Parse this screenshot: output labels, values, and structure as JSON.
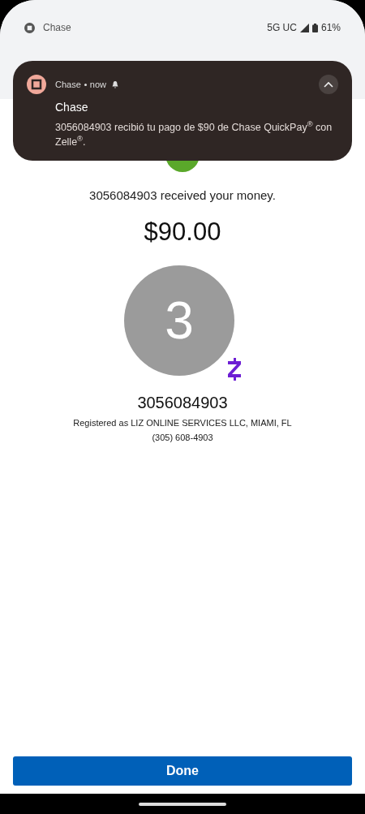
{
  "status_bar": {
    "app": "Chase",
    "network": "5G UC",
    "battery": "61%"
  },
  "notification": {
    "app": "Chase",
    "time": "now",
    "title": "Chase",
    "body": "3056084903 recibió tu pago de $90 de Chase QuickPay$^{®}$ con Zelle$^{®}$.",
    "expanded": true
  },
  "confirmation": {
    "message": "3056084903 received your money.",
    "amount": "$90.00"
  },
  "recipient": {
    "initial": "3",
    "name": "3056084903",
    "registered": "Registered as LIZ ONLINE SERVICES LLC, MIAMI, FL",
    "phone": "(305) 608-4903"
  },
  "done_button": "Done"
}
